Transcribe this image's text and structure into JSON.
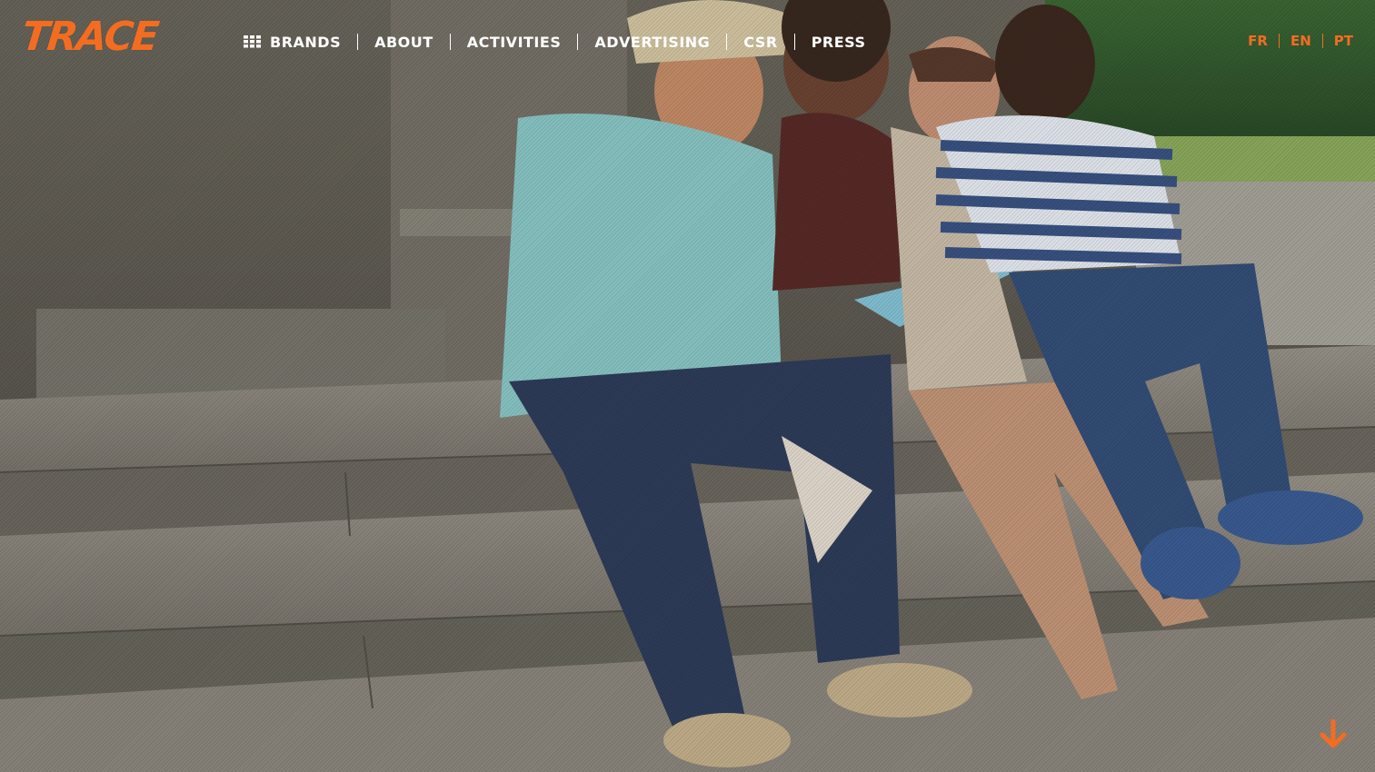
{
  "header": {
    "logo_text": "TRACE",
    "brand_color": "#f26d21"
  },
  "nav": {
    "brands": "BRANDS",
    "about": "ABOUT",
    "activities": "ACTIVITIES",
    "advertising": "ADVERTISING",
    "csr": "CSR",
    "press": "PRESS",
    "brands_icon": "grid-icon"
  },
  "languages": {
    "fr": "FR",
    "en": "EN",
    "pt": "PT"
  },
  "hero": {
    "image": "four friends sitting on stone steps looking at a tablet",
    "scroll_icon": "arrow-down-icon"
  }
}
